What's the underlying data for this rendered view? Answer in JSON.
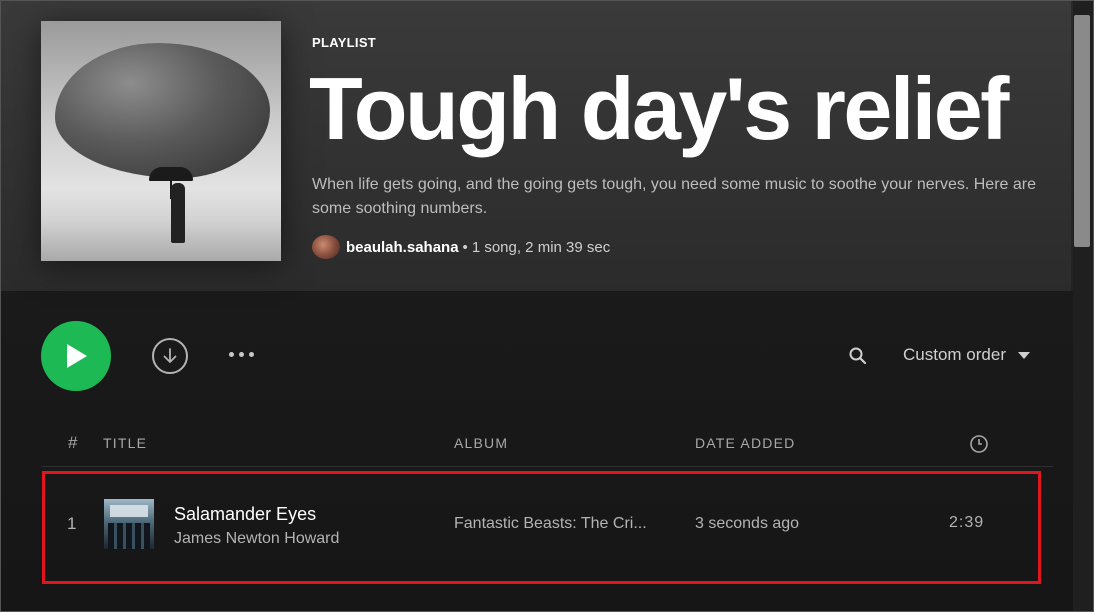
{
  "playlist": {
    "type_label": "PLAYLIST",
    "title": "Tough day's relief",
    "description": "When life gets going, and the going gets tough, you need some music to soothe your nerves. Here are some soothing numbers.",
    "owner": "beaulah.sahana",
    "stats": "1 song, 2 min 39 sec",
    "separator": "•"
  },
  "actions": {
    "sort_label": "Custom order",
    "play_icon": "play-icon",
    "download_icon": "download-icon",
    "more_icon": "more-icon",
    "search_icon": "search-icon"
  },
  "table": {
    "headers": {
      "index": "#",
      "title": "TITLE",
      "album": "ALBUM",
      "date_added": "DATE ADDED",
      "duration_icon": "clock-icon"
    },
    "rows": [
      {
        "index": "1",
        "title": "Salamander Eyes",
        "artist": "James Newton Howard",
        "album": "Fantastic Beasts: The Cri...",
        "date_added": "3 seconds ago",
        "duration": "2:39"
      }
    ]
  },
  "colors": {
    "accent": "#1db954",
    "highlight_border": "#e0161f",
    "background": "#181818"
  }
}
